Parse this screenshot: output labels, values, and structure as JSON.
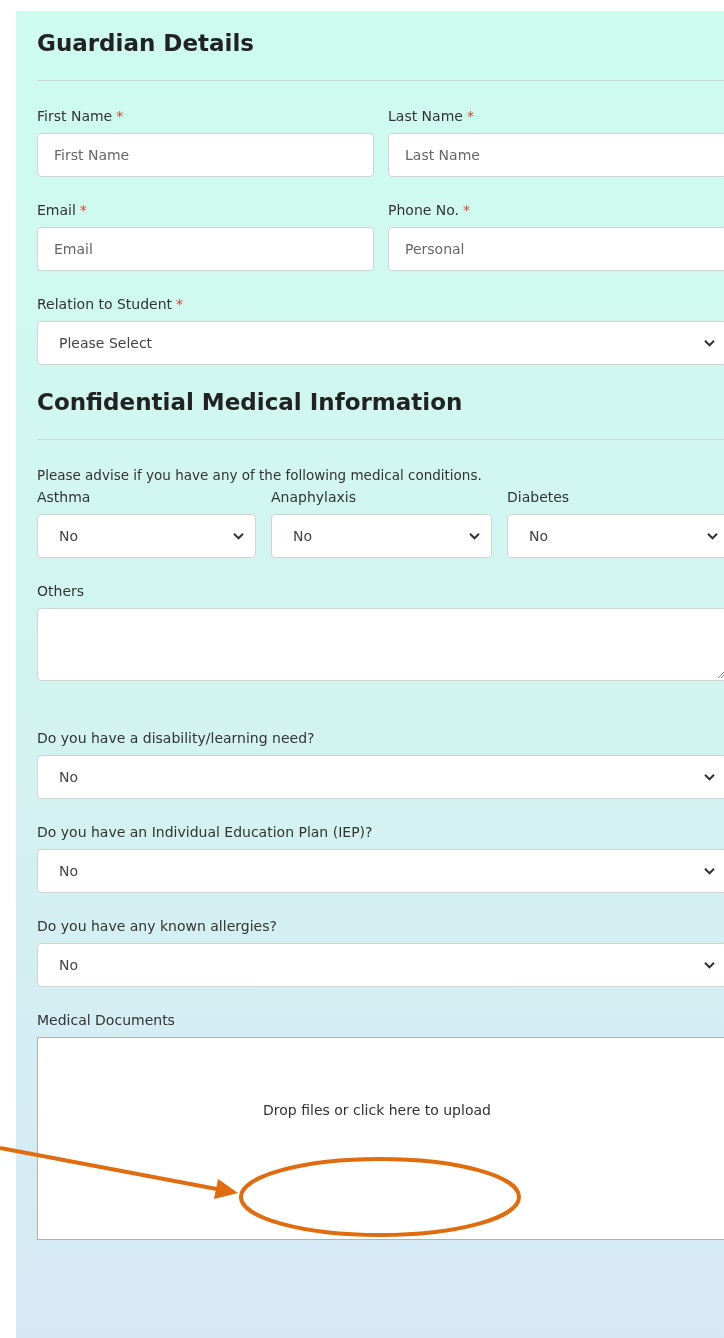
{
  "sections": [
    {
      "title": "Guardian Details",
      "blocks": [
        {
          "kind": "row",
          "fields": [
            {
              "kind": "text",
              "label": "First Name",
              "required_mark": "*",
              "placeholder": "First Name"
            },
            {
              "kind": "text",
              "label": "Last Name",
              "required_mark": "*",
              "placeholder": "Last Name"
            }
          ]
        },
        {
          "kind": "row",
          "fields": [
            {
              "kind": "text",
              "label": "Email",
              "required_mark": "*",
              "placeholder": "Email"
            },
            {
              "kind": "text",
              "label": "Phone No.",
              "required_mark": "*",
              "placeholder": "Personal"
            }
          ]
        },
        {
          "kind": "row",
          "fields": [
            {
              "kind": "select",
              "label": "Relation to Student",
              "required_mark": "*",
              "value": "Please Select"
            }
          ]
        }
      ]
    },
    {
      "title": "Confidential Medical Information",
      "blocks": [
        {
          "kind": "note",
          "text": "Please advise if you have any of the following medical conditions."
        },
        {
          "kind": "row",
          "fields": [
            {
              "kind": "select",
              "label": "Asthma",
              "value": "No"
            },
            {
              "kind": "select",
              "label": "Anaphylaxis",
              "value": "No"
            },
            {
              "kind": "select",
              "label": "Diabetes",
              "value": "No"
            }
          ]
        },
        {
          "kind": "row",
          "fields": [
            {
              "kind": "textarea",
              "label": "Others"
            }
          ]
        },
        {
          "kind": "row",
          "fields": [
            {
              "kind": "select",
              "label": "Do you have a disability/learning need?",
              "value": "No"
            }
          ]
        },
        {
          "kind": "row",
          "fields": [
            {
              "kind": "select",
              "label": "Do you have an Individual Education Plan (IEP)?",
              "value": "No"
            }
          ]
        },
        {
          "kind": "row",
          "fields": [
            {
              "kind": "select",
              "label": "Do you have any known allergies?",
              "value": "No"
            }
          ]
        },
        {
          "kind": "row",
          "fields": [
            {
              "kind": "upload",
              "label": "Medical Documents",
              "prompt": "Drop files or click here to upload"
            }
          ]
        }
      ]
    }
  ]
}
